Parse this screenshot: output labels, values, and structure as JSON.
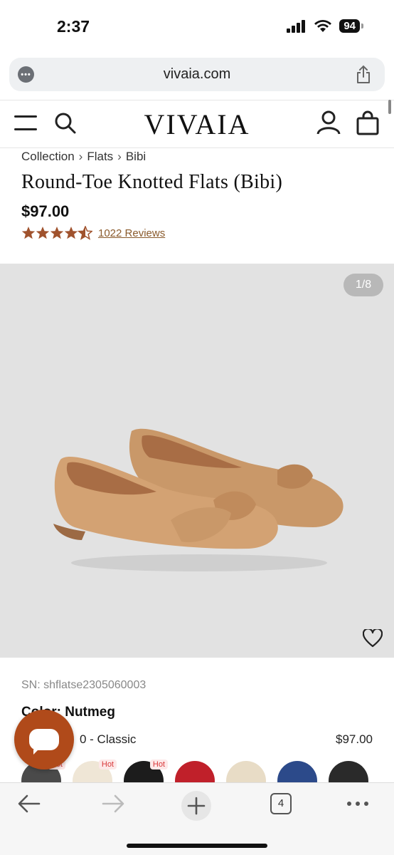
{
  "status": {
    "time": "2:37",
    "battery": "94"
  },
  "browser": {
    "url": "vivaia.com",
    "tabs_count": "4"
  },
  "header": {
    "logo": "VIVAIA"
  },
  "product": {
    "breadcrumb": [
      "Collection",
      "Flats",
      "Bibi"
    ],
    "title": "Round-Toe Knotted Flats (Bibi)",
    "price": "$97.00",
    "rating": 4.5,
    "reviews": "1022 Reviews",
    "image_counter": "1/8",
    "sn": "SN: shflatse2305060003",
    "color_label": "Color:",
    "color_value": "Nutmeg",
    "variant": "0 - Classic",
    "variant_price": "$97.00"
  },
  "swatches": [
    {
      "color": "#4a4a4a",
      "hot": "Hot"
    },
    {
      "color": "#efe6d6",
      "hot": "Hot"
    },
    {
      "color": "#1c1c1c",
      "hot": "Hot"
    },
    {
      "color": "#c0202a",
      "hot": ""
    },
    {
      "color": "#e8dcc6",
      "hot": ""
    },
    {
      "color": "#2c4a8a",
      "hot": ""
    },
    {
      "color": "#2a2a2a",
      "hot": ""
    }
  ],
  "colors": {
    "accent": "#b04a1a",
    "star": "#a0522d"
  }
}
